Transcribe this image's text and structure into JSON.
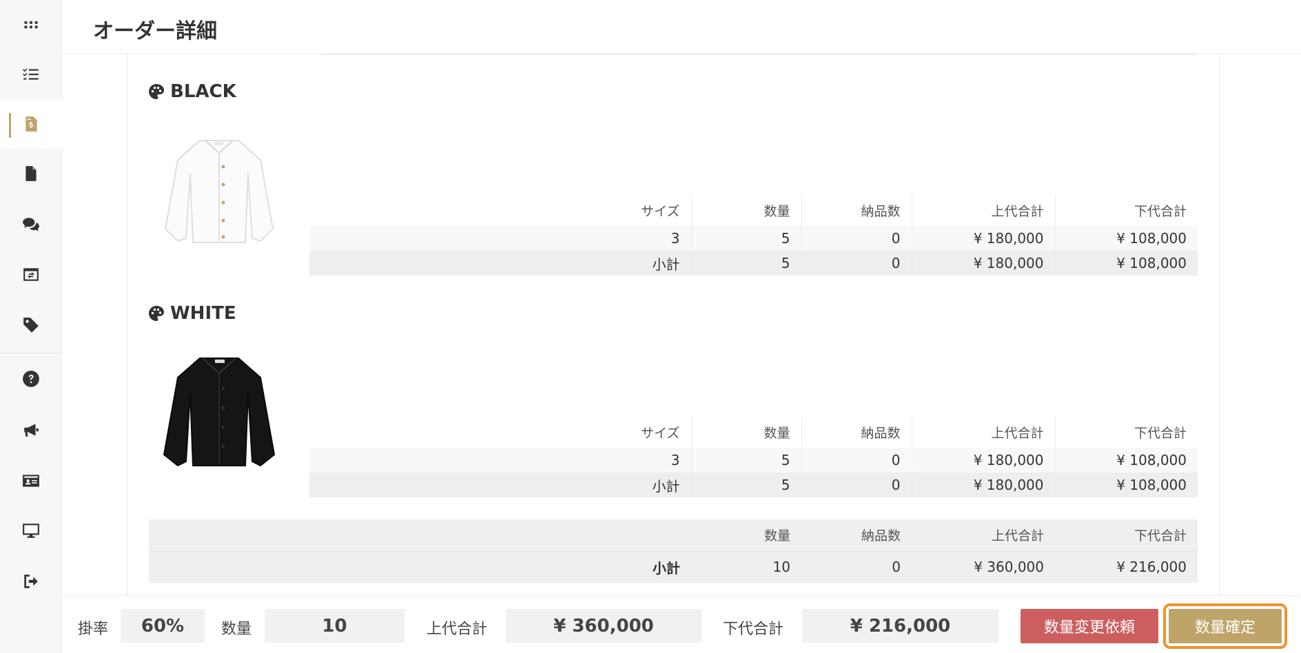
{
  "header": {
    "title": "オーダー詳細"
  },
  "sidebar": {
    "items": [
      {
        "icon": "grid-icon"
      },
      {
        "icon": "checklist-icon"
      },
      {
        "icon": "invoice-icon",
        "active": true
      },
      {
        "icon": "document-icon"
      },
      {
        "icon": "chat-icon"
      },
      {
        "icon": "calendar-icon"
      },
      {
        "icon": "tag-icon"
      },
      {
        "icon": "help-icon"
      },
      {
        "icon": "megaphone-icon"
      },
      {
        "icon": "id-card-icon"
      },
      {
        "icon": "monitor-icon"
      },
      {
        "icon": "logout-icon"
      }
    ]
  },
  "table_headers": {
    "size": "サイズ",
    "qty": "数量",
    "delivered": "納品数",
    "retail_total": "上代合計",
    "wholesale_total": "下代合計"
  },
  "variants": [
    {
      "color": "BLACK",
      "row": {
        "size": "3",
        "qty": "5",
        "delivered": "0",
        "retail_total": "¥ 180,000",
        "wholesale_total": "¥ 108,000"
      },
      "subtotal": {
        "label": "小計",
        "qty": "5",
        "delivered": "0",
        "retail_total": "¥ 180,000",
        "wholesale_total": "¥ 108,000"
      }
    },
    {
      "color": "WHITE",
      "row": {
        "size": "3",
        "qty": "5",
        "delivered": "0",
        "retail_total": "¥ 180,000",
        "wholesale_total": "¥ 108,000"
      },
      "subtotal": {
        "label": "小計",
        "qty": "5",
        "delivered": "0",
        "retail_total": "¥ 180,000",
        "wholesale_total": "¥ 108,000"
      }
    }
  ],
  "grand_total": {
    "label": "小計",
    "qty": "10",
    "delivered": "0",
    "retail_total": "¥ 360,000",
    "wholesale_total": "¥ 216,000"
  },
  "footer": {
    "rate_label": "掛率",
    "rate_value": "60%",
    "qty_label": "数量",
    "qty_value": "10",
    "retail_label": "上代合計",
    "retail_value": "¥ 360,000",
    "wholesale_label": "下代合計",
    "wholesale_value": "¥ 216,000",
    "request_change_button": "数量変更依頼",
    "confirm_button": "数量確定"
  },
  "colors": {
    "accent": "#bfa46a",
    "danger": "#cc5e5e",
    "highlight": "#f0932b"
  }
}
